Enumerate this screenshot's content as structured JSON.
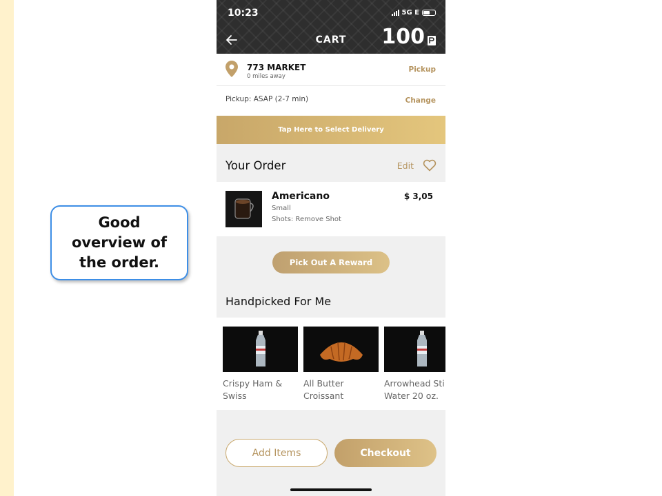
{
  "callout": {
    "text": "Good overview of the order."
  },
  "status_bar": {
    "time": "10:23",
    "network": "5G E"
  },
  "header": {
    "title": "CART",
    "points": "100"
  },
  "store": {
    "name": "773 MARKET",
    "distance": "0 miles away",
    "mode_link": "Pickup"
  },
  "pickup": {
    "text": "Pickup:  ASAP (2-7 min)",
    "change_link": "Change"
  },
  "delivery_banner": "Tap Here to Select Delivery",
  "order": {
    "title": "Your Order",
    "edit_label": "Edit",
    "items": [
      {
        "name": "Americano",
        "size": "Small",
        "modifier": "Shots: Remove Shot",
        "price": "$ 3,05"
      }
    ]
  },
  "reward_button": "Pick Out A Reward",
  "handpicked": {
    "title": "Handpicked For Me",
    "items": [
      {
        "label": "Crispy Ham &\nSwiss",
        "image": "bottle"
      },
      {
        "label": "All Butter\nCroissant",
        "image": "croissant"
      },
      {
        "label": "Arrowhead Sti\nWater 20 oz.",
        "image": "bottle"
      }
    ]
  },
  "actions": {
    "add_items": "Add Items",
    "checkout": "Checkout"
  },
  "colors": {
    "gold": "#b5945f",
    "header_bg": "#2e2e2e",
    "callout_border": "#3d8ee6",
    "left_strip": "#fff2cc"
  }
}
